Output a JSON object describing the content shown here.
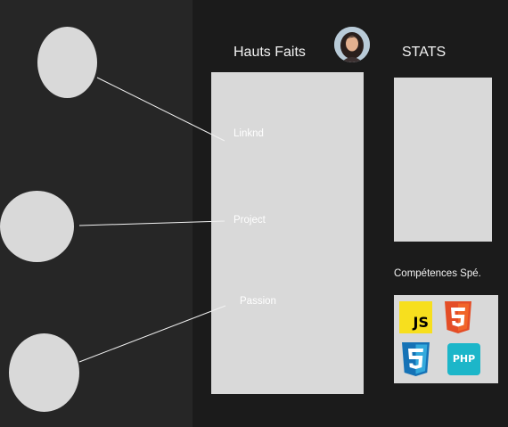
{
  "header": {
    "hauts_faits_title": "Hauts Faits",
    "stats_title": "STATS"
  },
  "hauts_faits": {
    "items": [
      {
        "label": "Linknd"
      },
      {
        "label": "Project"
      },
      {
        "label": "Passion"
      }
    ]
  },
  "skills": {
    "title": "Compétences Spé.",
    "badges": [
      {
        "icon": "javascript-icon",
        "label": "JS",
        "color": "#f7df1e"
      },
      {
        "icon": "html5-icon",
        "color": "#e44d26"
      },
      {
        "icon": "css3-icon",
        "color": "#1572b6"
      },
      {
        "icon": "php-icon",
        "label": "PHP",
        "color": "#1cb6c9"
      }
    ]
  },
  "colors": {
    "background": "#1b1b1b",
    "left_panel": "#262626",
    "placeholder": "#d9d9d9",
    "text": "#f2f2f2"
  }
}
